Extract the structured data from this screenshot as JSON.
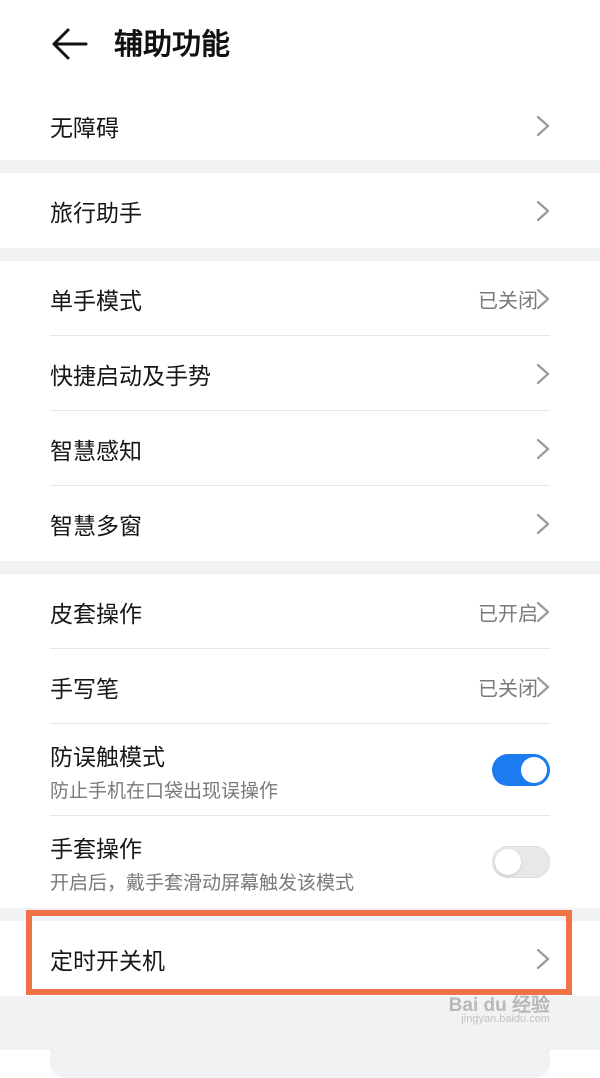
{
  "header": {
    "title": "辅助功能",
    "back_icon": "arrow-left-icon"
  },
  "groups": [
    {
      "items": [
        {
          "label": "无障碍"
        }
      ]
    },
    {
      "items": [
        {
          "label": "旅行助手"
        }
      ]
    },
    {
      "items": [
        {
          "label": "单手模式",
          "value": "已关闭"
        },
        {
          "label": "快捷启动及手势"
        },
        {
          "label": "智慧感知"
        },
        {
          "label": "智慧多窗"
        }
      ]
    },
    {
      "items": [
        {
          "label": "皮套操作",
          "value": "已开启"
        },
        {
          "label": "手写笔",
          "value": "已关闭"
        },
        {
          "label": "防误触模式",
          "sub": "防止手机在口袋出现误操作",
          "toggle": true
        },
        {
          "label": "手套操作",
          "sub": "开启后，戴手套滑动屏幕触发该模式",
          "toggle": false
        }
      ]
    },
    {
      "items": [
        {
          "label": "定时开关机"
        }
      ]
    }
  ],
  "watermark": {
    "main": "Bai du 经验",
    "sub": "jingyan.baidu.com"
  },
  "colors": {
    "toggle_on": "#1d7bf0",
    "highlight": "#f07246",
    "separator": "#f1f2f4"
  }
}
